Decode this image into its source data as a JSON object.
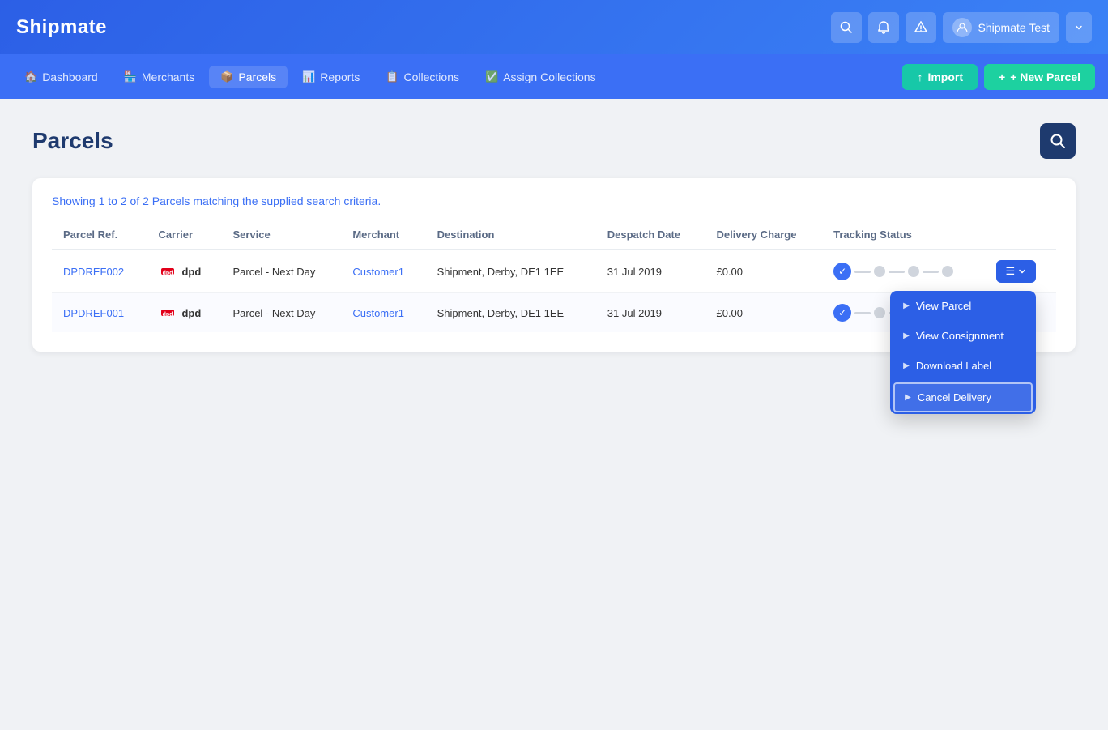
{
  "app": {
    "logo": "Shipmate"
  },
  "header": {
    "user_name": "Shipmate Test",
    "search_title": "Search",
    "notifications_title": "Notifications",
    "alerts_title": "Alerts"
  },
  "nav": {
    "items": [
      {
        "id": "dashboard",
        "label": "Dashboard",
        "icon": "🏠",
        "active": false
      },
      {
        "id": "merchants",
        "label": "Merchants",
        "icon": "🏪",
        "active": false
      },
      {
        "id": "parcels",
        "label": "Parcels",
        "icon": "📦",
        "active": true
      },
      {
        "id": "reports",
        "label": "Reports",
        "icon": "📊",
        "active": false
      },
      {
        "id": "collections",
        "label": "Collections",
        "icon": "📋",
        "active": false
      },
      {
        "id": "assign-collections",
        "label": "Assign Collections",
        "icon": "✅",
        "active": false
      }
    ],
    "import_label": "↑ Import",
    "new_parcel_label": "+ New Parcel"
  },
  "page": {
    "title": "Parcels",
    "results_info": "Showing 1 to 2 of 2 Parcels matching the supplied search criteria."
  },
  "table": {
    "headers": [
      "Parcel Ref.",
      "Carrier",
      "Service",
      "Merchant",
      "Destination",
      "Despatch Date",
      "Delivery Charge",
      "Tracking Status",
      ""
    ],
    "rows": [
      {
        "ref": "DPDREF002",
        "carrier": "dpd",
        "service": "Parcel - Next Day",
        "merchant": "Customer1",
        "destination": "Shipment, Derby, DE1 1EE",
        "despatch_date": "31 Jul 2019",
        "delivery_charge": "£0.00",
        "has_dropdown": true
      },
      {
        "ref": "DPDREF001",
        "carrier": "dpd",
        "service": "Parcel - Next Day",
        "merchant": "Customer1",
        "destination": "Shipment, Derby, DE1 1EE",
        "despatch_date": "31 Jul 2019",
        "delivery_charge": "£0.00",
        "has_dropdown": false
      }
    ]
  },
  "dropdown_menu": {
    "items": [
      {
        "id": "view-parcel",
        "label": "View Parcel",
        "active": false
      },
      {
        "id": "view-consignment",
        "label": "View Consignment",
        "active": false
      },
      {
        "id": "download-label",
        "label": "Download Label",
        "active": false
      },
      {
        "id": "cancel-delivery",
        "label": "Cancel Delivery",
        "active": true
      }
    ]
  }
}
